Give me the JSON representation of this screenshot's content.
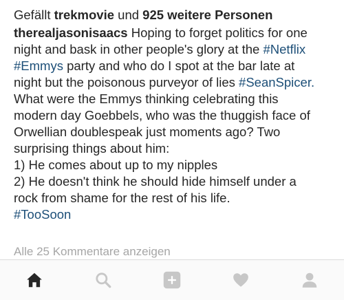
{
  "likes": {
    "prefix": "Gefällt",
    "user": "trekmovie",
    "conjunction": "und",
    "others": "925 weitere Personen"
  },
  "caption": {
    "username": "therealjasonisaacs",
    "line1": "Hoping to forget politics for one",
    "line2_text": "night and bask in other people's glory at the",
    "hashtag_netflix": "#Netflix",
    "hashtag_emmys": "#Emmys",
    "line3_text": "party and who do I spot at the bar late at",
    "line4_text": "night but the poisonous purveyor of lies",
    "hashtag_seanspicer": "#SeanSpicer.",
    "line5": "What were the Emmys thinking celebrating this",
    "line6": "modern day Goebbels, who was the thuggish face of",
    "line7": "Orwellian doublespeak just moments ago? Two",
    "line8": "surprising things about him:",
    "line9": "1) He comes about up to my nipples",
    "line10": "2) He doesn't think he should hide himself under a",
    "line11": "rock from shame for the rest of his life.",
    "hashtag_toosoon": "#TooSoon"
  },
  "comments_link": "Alle 25 Kommentare anzeigen",
  "nav": {
    "active_tab": "home",
    "items": [
      "home-icon",
      "search-icon",
      "add-post-icon",
      "heart-icon",
      "profile-icon"
    ]
  },
  "colors": {
    "hashtag": "#1d4f78",
    "text": "#262626",
    "muted": "#a6a6a6",
    "icon_inactive": "#c7c7c7",
    "icon_active": "#262626"
  }
}
